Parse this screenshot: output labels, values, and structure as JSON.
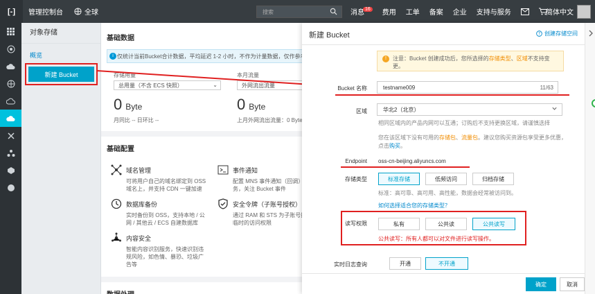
{
  "topbar": {
    "logo": "[-]",
    "title": "管理控制台",
    "region": "全球",
    "search_placeholder": "搜索",
    "links": [
      {
        "label": "消息",
        "badge": "16"
      },
      {
        "label": "费用"
      },
      {
        "label": "工单"
      },
      {
        "label": "备案"
      },
      {
        "label": "企业"
      },
      {
        "label": "支持与服务"
      }
    ],
    "language": "简体中文"
  },
  "subnav": {
    "title": "对象存储",
    "overview": "概览",
    "create_button": "新建 Bucket"
  },
  "main": {
    "basic_data_title": "基础数据",
    "info_text": "仅统计当前Bucket合计数据，平均延迟 1-2 小时，不作为计量数据，仅作参考",
    "storage": {
      "label": "存储用量",
      "select": "总用量（不含 ECS 快照）",
      "value": "0",
      "unit": "Byte",
      "foot": "月同比 --   日环比 --"
    },
    "traffic": {
      "label": "本月流量",
      "select": "外网流出流量",
      "value": "0",
      "unit": "Byte",
      "foot": "上月外网流出流量：0 Byte"
    },
    "config_title": "基础配置",
    "features": [
      {
        "name": "域名管理",
        "desc": "可将用户自己的域名绑定到 OSS 域名上，并支持 CDN 一键加速"
      },
      {
        "name": "事件通知",
        "desc": "配置 MNS 事件通知（回调）服务，关注 Bucket 事件"
      },
      {
        "name": "数据库备份",
        "desc": "实时备份到 OSS，支持本地 / 公网 / 其他云 / ECS 自建数据库"
      },
      {
        "name": "安全令牌（子账号授权）",
        "desc": "通过 RAM 和 STS 为子账号授予临时的访问权限"
      },
      {
        "name": "内容安全",
        "desc": "智能内容识别服务，快速识别违规风险，如色情、暴恐、垃圾广告等"
      }
    ],
    "data_title": "数据处理"
  },
  "drawer": {
    "title": "新建 Bucket",
    "help_link": "创建存储空间",
    "notice_pre": "注意：Bucket 创建成功后，您所选择的",
    "notice_em1": "存储类型",
    "notice_mid": "、",
    "notice_em2": "区域",
    "notice_post": "不支持变更。",
    "bucket_label": "Bucket 名称",
    "bucket_value": "testname009",
    "bucket_count": "11/63",
    "region_label": "区域",
    "region_value": "华北2（北京）",
    "region_help": "相同区域内的产品内网可以互通；订购后不支持更换区域，请谨慎选择",
    "region_help2_pre": "您在该区域下没有可用的",
    "region_help2_em1": "存储包",
    "region_help2_mid": "、",
    "region_help2_em2": "流量包",
    "region_help2_post": "。建议您购买资源包享受更多优惠，",
    "region_help3_pre": "点击",
    "region_help3_link": "购买",
    "region_help3_post": "。",
    "endpoint_label": "Endpoint",
    "endpoint_value": "oss-cn-beijing.aliyuncs.com",
    "storage_label": "存储类型",
    "storage_options": [
      "标准存储",
      "低频访问",
      "归档存储"
    ],
    "storage_help": "标准：高可靠、高可用、高性能，数据会经常被访问到。",
    "storage_link": "如何选择适合您的存储类型？",
    "acl_label": "读写权限",
    "acl_options": [
      "私有",
      "公共读",
      "公共读写"
    ],
    "acl_warning": "公共读写：所有人都可以对文件进行读写操作。",
    "log_label": "实时日志查询",
    "log_options": [
      "开通",
      "不开通"
    ],
    "ok_button": "确定",
    "cancel_button": "取消"
  },
  "colors": {
    "accent": "#00a2ca",
    "highlight": "#e02020",
    "topbar": "#373d41",
    "rail_active": "#00c1de"
  }
}
